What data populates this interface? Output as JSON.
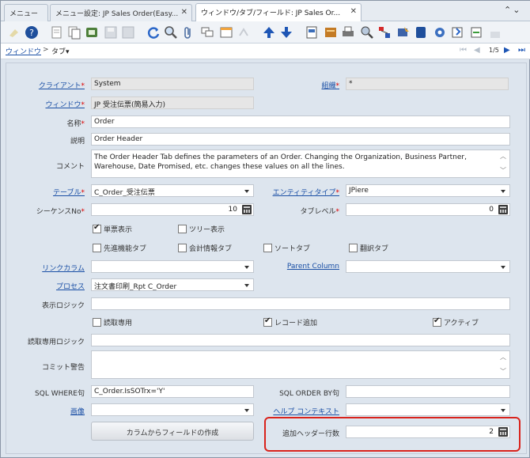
{
  "tabs": [
    {
      "label": "メニュー"
    },
    {
      "label": "メニュー設定: JP Sales Order(Easy..."
    },
    {
      "label": "ウィンドウ/タブ/フィールド: JP Sales Or..."
    }
  ],
  "breadcrumb": {
    "window": "ウィンドウ",
    "sep": ">",
    "current": "タブ▾"
  },
  "pager": "1/5",
  "form": {
    "client": {
      "label": "クライアント",
      "value": "System"
    },
    "org": {
      "label": "組織",
      "value": "*"
    },
    "window": {
      "label": "ウィンドウ",
      "value": "JP 受注伝票(簡易入力)"
    },
    "name": {
      "label": "名称",
      "value": "Order"
    },
    "description": {
      "label": "説明",
      "value": "Order Header"
    },
    "comment": {
      "label": "コメント",
      "value": "The Order Header Tab defines the parameters of an Order. Changing the Organization, Business Partner, Warehouse, Date Promised, etc. changes these values on all the lines."
    },
    "table": {
      "label": "テーブル",
      "value": "C_Order_受注伝票"
    },
    "entity_type": {
      "label": "エンティティタイプ",
      "value": "JPiere"
    },
    "seq": {
      "label": "シーケンスNo",
      "value": "10"
    },
    "tab_level": {
      "label": "タブレベル",
      "value": "0"
    },
    "single_row": "単票表示",
    "tree_view": "ツリー表示",
    "advanced_tab": "先進機能タブ",
    "accounting_tab": "会計情報タブ",
    "sort_tab": "ソートタブ",
    "translation_tab": "翻訳タブ",
    "link_column": {
      "label": "リンクカラム",
      "value": ""
    },
    "parent_column": {
      "label": "Parent Column",
      "value": ""
    },
    "process": {
      "label": "プロセス",
      "value": "注文書印刷_Rpt C_Order"
    },
    "display_logic": {
      "label": "表示ロジック",
      "value": ""
    },
    "read_only": "読取専用",
    "insert_record": "レコード追加",
    "active": "アクティブ",
    "readonly_logic": {
      "label": "読取専用ロジック",
      "value": ""
    },
    "commit_warning": {
      "label": "コミット警告",
      "value": ""
    },
    "where": {
      "label": "SQL WHERE句",
      "value": "C_Order.IsSOTrx='Y'"
    },
    "orderby": {
      "label": "SQL ORDER BY句",
      "value": ""
    },
    "image": {
      "label": "画像",
      "value": ""
    },
    "help_context": {
      "label": "ヘルプ コンテキスト",
      "value": ""
    },
    "create_fields_button": "カラムからフィールドの作成",
    "extra_header_rows": {
      "label": "追加ヘッダー行数",
      "value": "2"
    }
  }
}
